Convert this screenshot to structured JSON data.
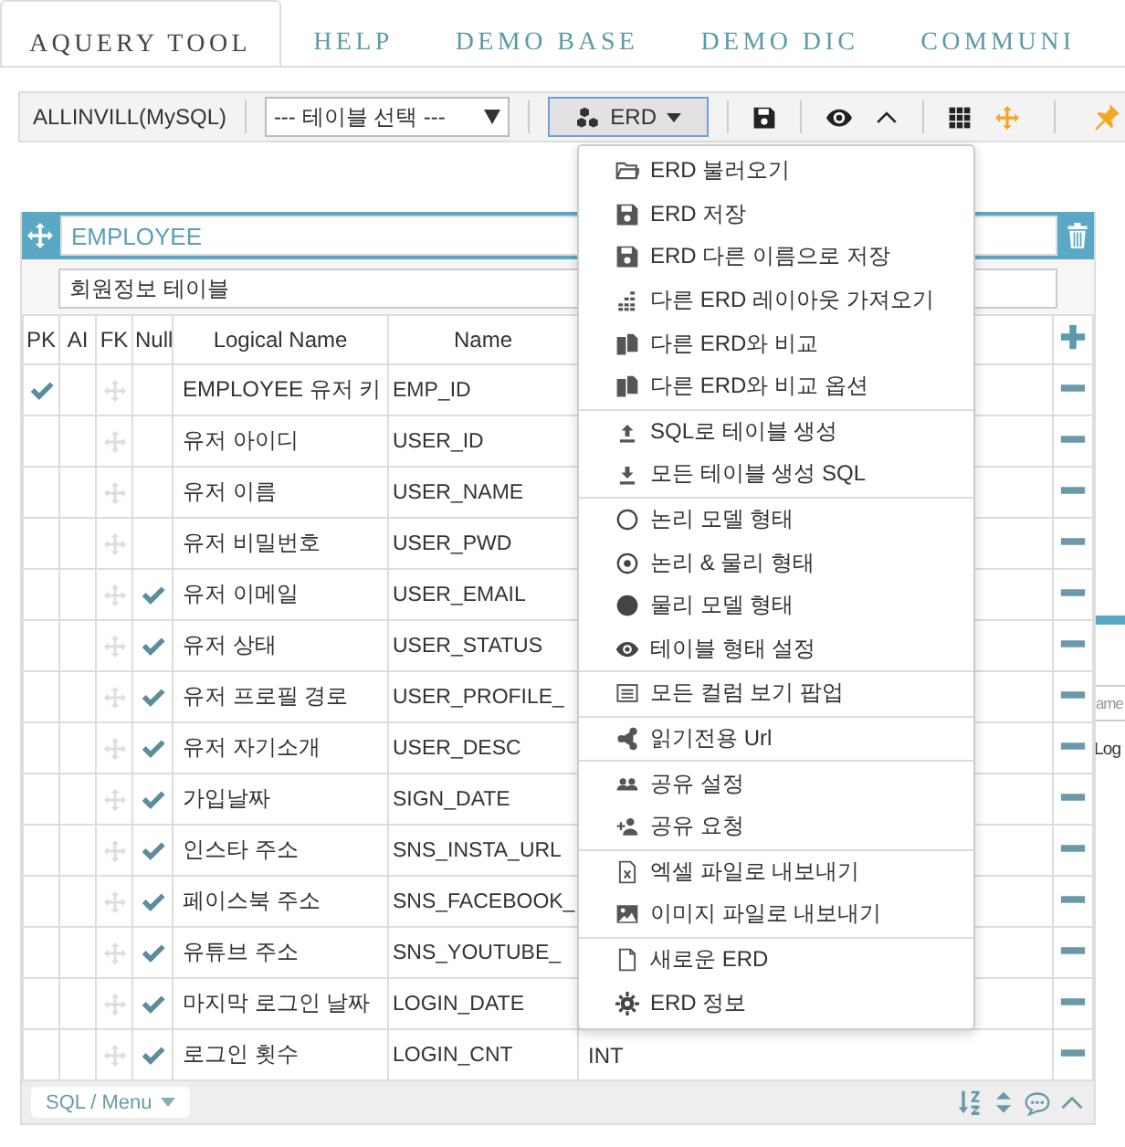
{
  "tabs": [
    {
      "label": "AQUERY TOOL",
      "selected": true
    },
    {
      "label": "HELP",
      "selected": false
    },
    {
      "label": "DEMO BASE",
      "selected": false
    },
    {
      "label": "DEMO DIC",
      "selected": false
    },
    {
      "label": "COMMUNI",
      "selected": false
    }
  ],
  "toolbar": {
    "connection": "ALLINVILL(MySQL)",
    "table_select": "--- 테이블 선택 ---",
    "erd_button": {
      "label": "ERD",
      "expanded": true
    }
  },
  "table": {
    "name": "EMPLOYEE",
    "comment": "회원정보 테이블",
    "columns": [
      "PK",
      "AI",
      "FK",
      "Null",
      "Logical Name",
      "Name"
    ],
    "rows": [
      {
        "pk": true,
        "null": false,
        "logical_name": "EMPLOYEE 유저 키",
        "name": "EMP_ID"
      },
      {
        "pk": false,
        "null": false,
        "logical_name": "유저 아이디",
        "name": "USER_ID"
      },
      {
        "pk": false,
        "null": false,
        "logical_name": "유저 이름",
        "name": "USER_NAME"
      },
      {
        "pk": false,
        "null": false,
        "logical_name": "유저 비밀번호",
        "name": "USER_PWD"
      },
      {
        "pk": false,
        "null": true,
        "logical_name": "유저 이메일",
        "name": "USER_EMAIL"
      },
      {
        "pk": false,
        "null": true,
        "logical_name": "유저 상태",
        "name": "USER_STATUS"
      },
      {
        "pk": false,
        "null": true,
        "logical_name": "유저 프로필 경로",
        "name": "USER_PROFILE_"
      },
      {
        "pk": false,
        "null": true,
        "logical_name": "유저 자기소개",
        "name": "USER_DESC"
      },
      {
        "pk": false,
        "null": true,
        "logical_name": "가입날짜",
        "name": "SIGN_DATE"
      },
      {
        "pk": false,
        "null": true,
        "logical_name": "인스타 주소",
        "name": "SNS_INSTA_URL"
      },
      {
        "pk": false,
        "null": true,
        "logical_name": "페이스북 주소",
        "name": "SNS_FACEBOOK_"
      },
      {
        "pk": false,
        "null": true,
        "logical_name": "유튜브 주소",
        "name": "SNS_YOUTUBE_"
      },
      {
        "pk": false,
        "null": true,
        "logical_name": "마지막 로그인 날짜",
        "name": "LOGIN_DATE"
      },
      {
        "pk": false,
        "null": true,
        "logical_name": "로그인 횟수",
        "name": "LOGIN_CNT",
        "type": "INT"
      }
    ],
    "footer_button": "SQL / Menu"
  },
  "background_table": {
    "placeholder": "ame",
    "cell": "Log"
  },
  "menu": [
    [
      "ERD 불러오기",
      "ERD 저장",
      "ERD 다른 이름으로 저장",
      "다른 ERD 레이아웃 가져오기",
      "다른 ERD와 비교",
      "다른 ERD와 비교 옵션"
    ],
    [
      "SQL로 테이블 생성",
      "모든 테이블 생성 SQL"
    ],
    [
      "논리 모델 형태",
      "논리 & 물리 형태",
      "물리 모델 형태",
      "테이블 형태 설정"
    ],
    [
      "모든 컬럼 보기 팝업"
    ],
    [
      "읽기전용 Url"
    ],
    [
      "공유 설정",
      "공유 요청"
    ],
    [
      "엑셀 파일로 내보내기",
      "이미지 파일로 내보내기"
    ],
    [
      "새로운 ERD",
      "ERD 정보"
    ]
  ]
}
